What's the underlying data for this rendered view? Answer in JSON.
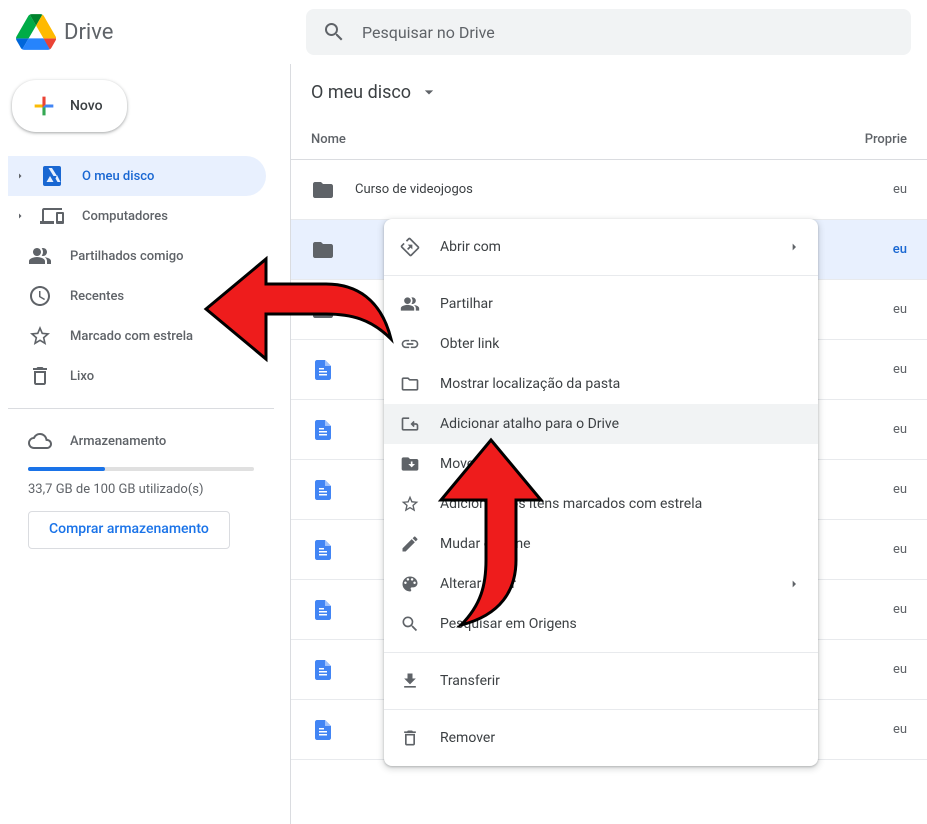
{
  "header": {
    "app_name": "Drive",
    "search_placeholder": "Pesquisar no Drive"
  },
  "sidebar": {
    "new_button": "Novo",
    "items": [
      {
        "label": "O meu disco",
        "icon": "drive",
        "active": true,
        "expandable": true
      },
      {
        "label": "Computadores",
        "icon": "computers",
        "active": false,
        "expandable": true
      },
      {
        "label": "Partilhados comigo",
        "icon": "shared",
        "active": false
      },
      {
        "label": "Recentes",
        "icon": "recent",
        "active": false
      },
      {
        "label": "Marcado com estrela",
        "icon": "star",
        "active": false
      },
      {
        "label": "Lixo",
        "icon": "trash",
        "active": false
      }
    ],
    "storage": {
      "label": "Armazenamento",
      "used_text": "33,7 GB de 100 GB utilizado(s)",
      "percent": 34,
      "buy_label": "Comprar armazenamento"
    }
  },
  "content": {
    "breadcrumb": "O meu disco",
    "columns": {
      "name": "Nome",
      "owner": "Proprie"
    },
    "rows": [
      {
        "type": "folder",
        "name": "Curso de videojogos",
        "owner": "eu"
      },
      {
        "type": "folder",
        "name": "",
        "owner": "eu",
        "selected": true
      },
      {
        "type": "folder",
        "name": "",
        "owner": "eu"
      },
      {
        "type": "doc",
        "name": "",
        "owner": "eu"
      },
      {
        "type": "doc",
        "name": "",
        "owner": "eu"
      },
      {
        "type": "doc",
        "name": "",
        "owner": "eu"
      },
      {
        "type": "doc",
        "name": "",
        "owner": "eu"
      },
      {
        "type": "doc",
        "name": "",
        "owner": "eu"
      },
      {
        "type": "doc",
        "name": "",
        "owner": "eu"
      },
      {
        "type": "doc",
        "name": "",
        "owner": "eu"
      }
    ]
  },
  "context_menu": {
    "items": [
      {
        "label": "Abrir com",
        "icon": "open-with",
        "submenu": true
      },
      {
        "divider": true
      },
      {
        "label": "Partilhar",
        "icon": "share"
      },
      {
        "label": "Obter link",
        "icon": "link"
      },
      {
        "label": "Mostrar localização da pasta",
        "icon": "folder-open"
      },
      {
        "label": "Adicionar atalho para o Drive",
        "icon": "drive-shortcut",
        "highlighted": true
      },
      {
        "label": "Mover para",
        "icon": "move-to"
      },
      {
        "label": "Adicionar aos itens marcados com estrela",
        "icon": "star"
      },
      {
        "label": "Mudar o nome",
        "icon": "rename"
      },
      {
        "label": "Alterar a cor",
        "icon": "palette",
        "submenu": true
      },
      {
        "label": "Pesquisar em Origens",
        "icon": "search"
      },
      {
        "divider": true
      },
      {
        "label": "Transferir",
        "icon": "download"
      },
      {
        "divider": true
      },
      {
        "label": "Remover",
        "icon": "trash"
      }
    ]
  }
}
